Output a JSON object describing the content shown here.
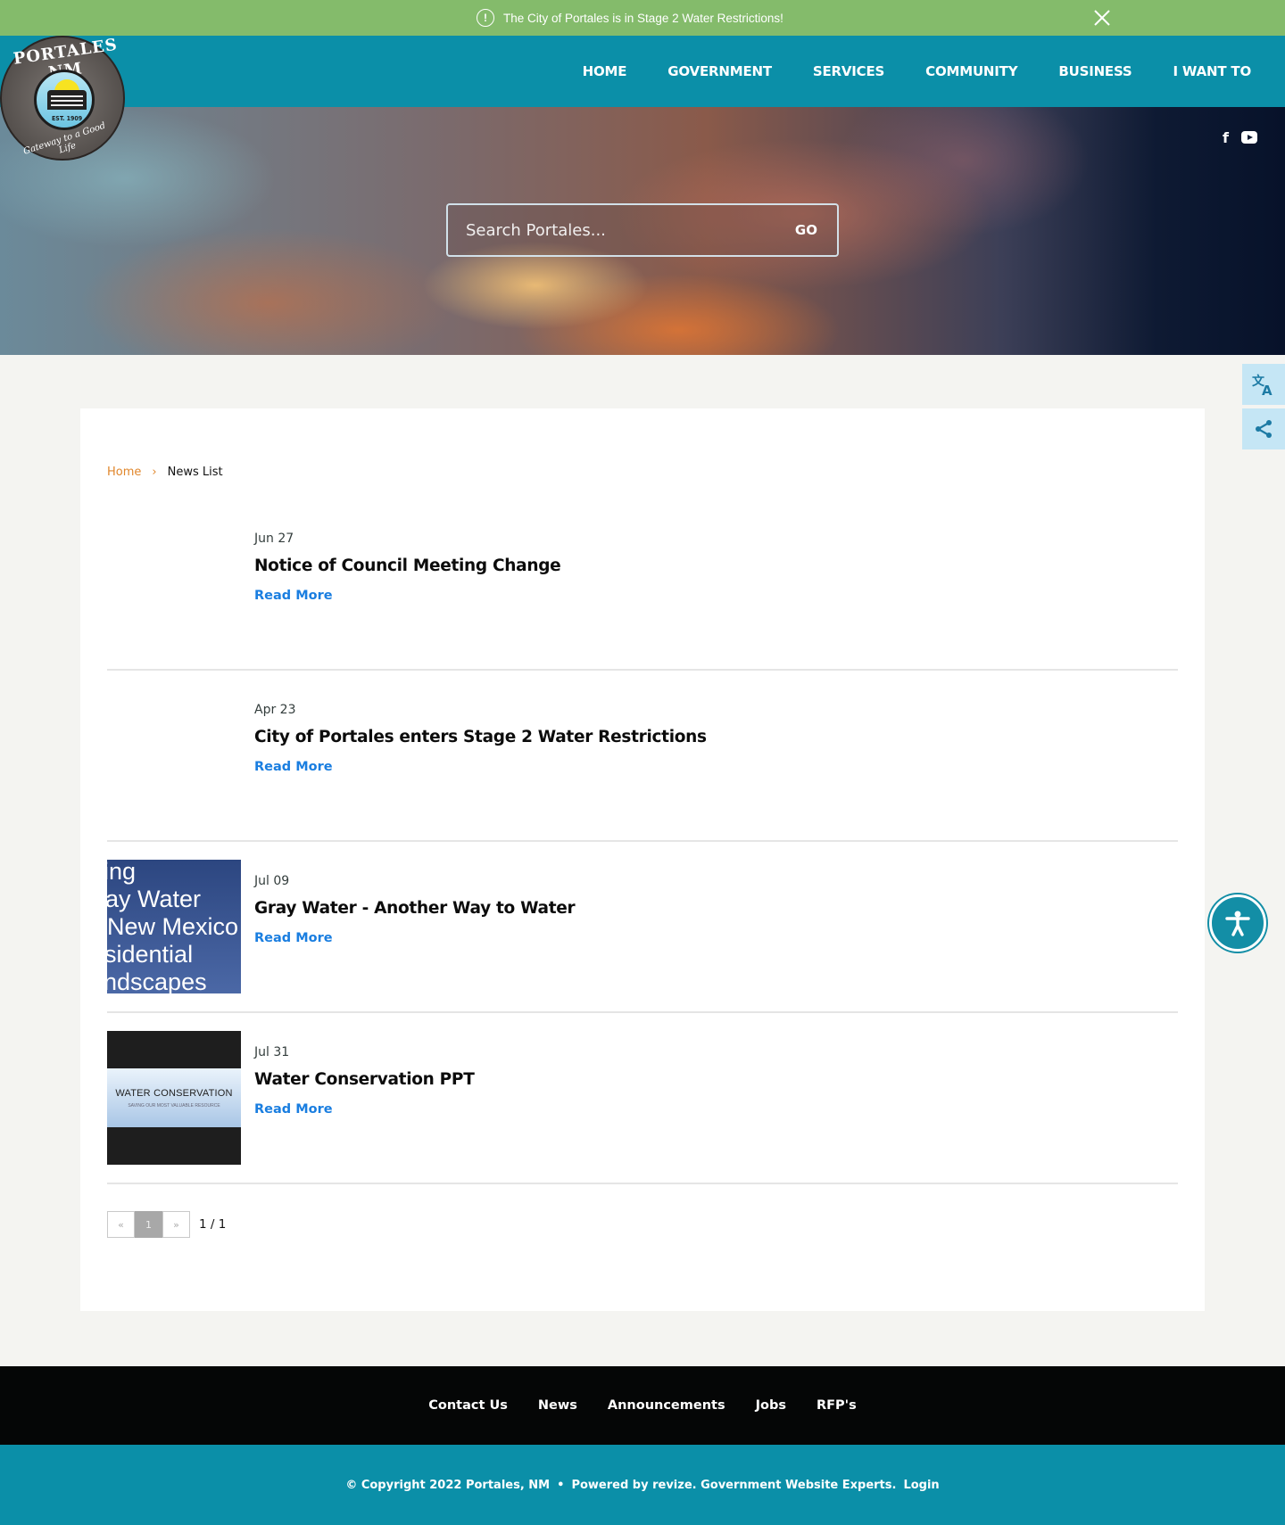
{
  "alert": {
    "icon": "exclamation-circle-icon",
    "message": "The City of Portales is in Stage 2 Water Restrictions!",
    "close_icon": "close-icon"
  },
  "logo": {
    "top_text": "PORTALES NM",
    "est": "EST. 1909",
    "tagline": "Gateway to a Good Life"
  },
  "nav": {
    "items": [
      {
        "label": "HOME"
      },
      {
        "label": "GOVERNMENT"
      },
      {
        "label": "SERVICES"
      },
      {
        "label": "COMMUNITY"
      },
      {
        "label": "BUSINESS"
      },
      {
        "label": "I WANT TO"
      }
    ]
  },
  "social": {
    "facebook": "f",
    "facebook_icon": "facebook-icon",
    "youtube_icon": "youtube-icon"
  },
  "search": {
    "placeholder": "Search Portales...",
    "value": "",
    "go_label": "GO"
  },
  "side_tools": {
    "translate_icon": "translate-icon",
    "share_icon": "share-icon",
    "accessibility_icon": "accessibility-icon"
  },
  "breadcrumb": {
    "home": "Home",
    "separator": "›",
    "current": "News List"
  },
  "news": [
    {
      "date": "Jun 27",
      "title": "Notice of Council Meeting Change",
      "link": "Read More",
      "thumbnail": null
    },
    {
      "date": "Apr 23",
      "title": "City of Portales enters Stage 2 Water Restrictions",
      "link": "Read More",
      "thumbnail": null
    },
    {
      "date": "Jul 09",
      "title": "Gray Water - Another Way to Water",
      "link": "Read More",
      "thumbnail": {
        "lines": [
          "ing",
          "ay Water",
          "New Mexico",
          "sidential",
          "ndscapes"
        ]
      }
    },
    {
      "date": "Jul 31",
      "title": "Water Conservation PPT",
      "link": "Read More",
      "thumbnail": {
        "title": "WATER CONSERVATION",
        "subtitle": "SAVING OUR MOST VALUABLE RESOURCE"
      }
    }
  ],
  "pagination": {
    "prev": "«",
    "current": "1",
    "next": "»",
    "info": "1 / 1"
  },
  "footer": {
    "links": [
      {
        "label": "Contact Us"
      },
      {
        "label": "News"
      },
      {
        "label": "Announcements"
      },
      {
        "label": "Jobs"
      },
      {
        "label": "RFP's"
      }
    ],
    "copyright": "© Copyright 2022 Portales, NM",
    "dot": "•",
    "powered": "Powered by revize. Government Website Experts.",
    "login": "Login"
  },
  "colors": {
    "alert_bg": "#84bb6b",
    "nav_bg": "#0b8fa8",
    "link_blue": "#1a7ee0",
    "breadcrumb_orange": "#e0862b",
    "footer_dark": "#050606"
  }
}
